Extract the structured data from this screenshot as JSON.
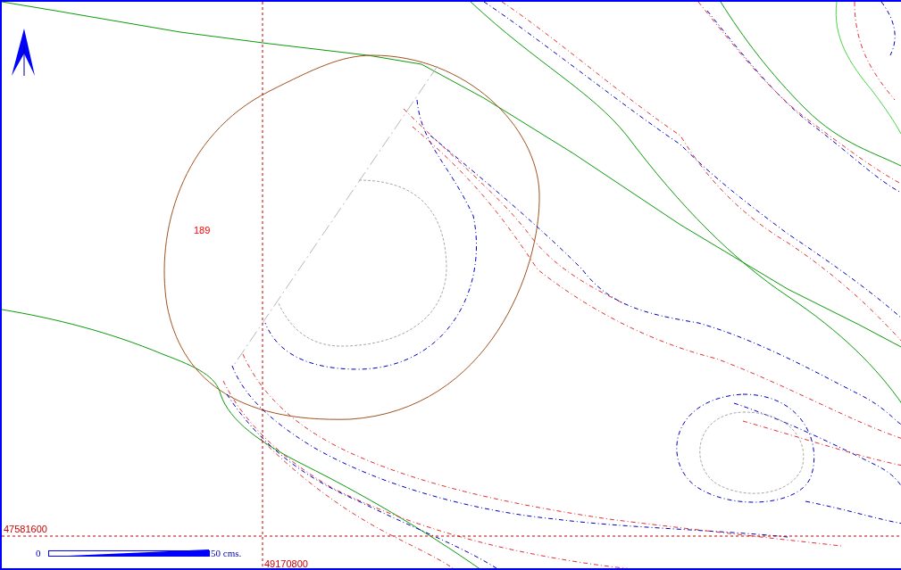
{
  "map": {
    "parcel_label": "189",
    "grid_labels": [
      {
        "kind": "northing",
        "text": "47581600"
      },
      {
        "kind": "easting",
        "text": "49170800"
      }
    ],
    "scale_bar": {
      "start": "0",
      "end": "50 cms."
    }
  }
}
